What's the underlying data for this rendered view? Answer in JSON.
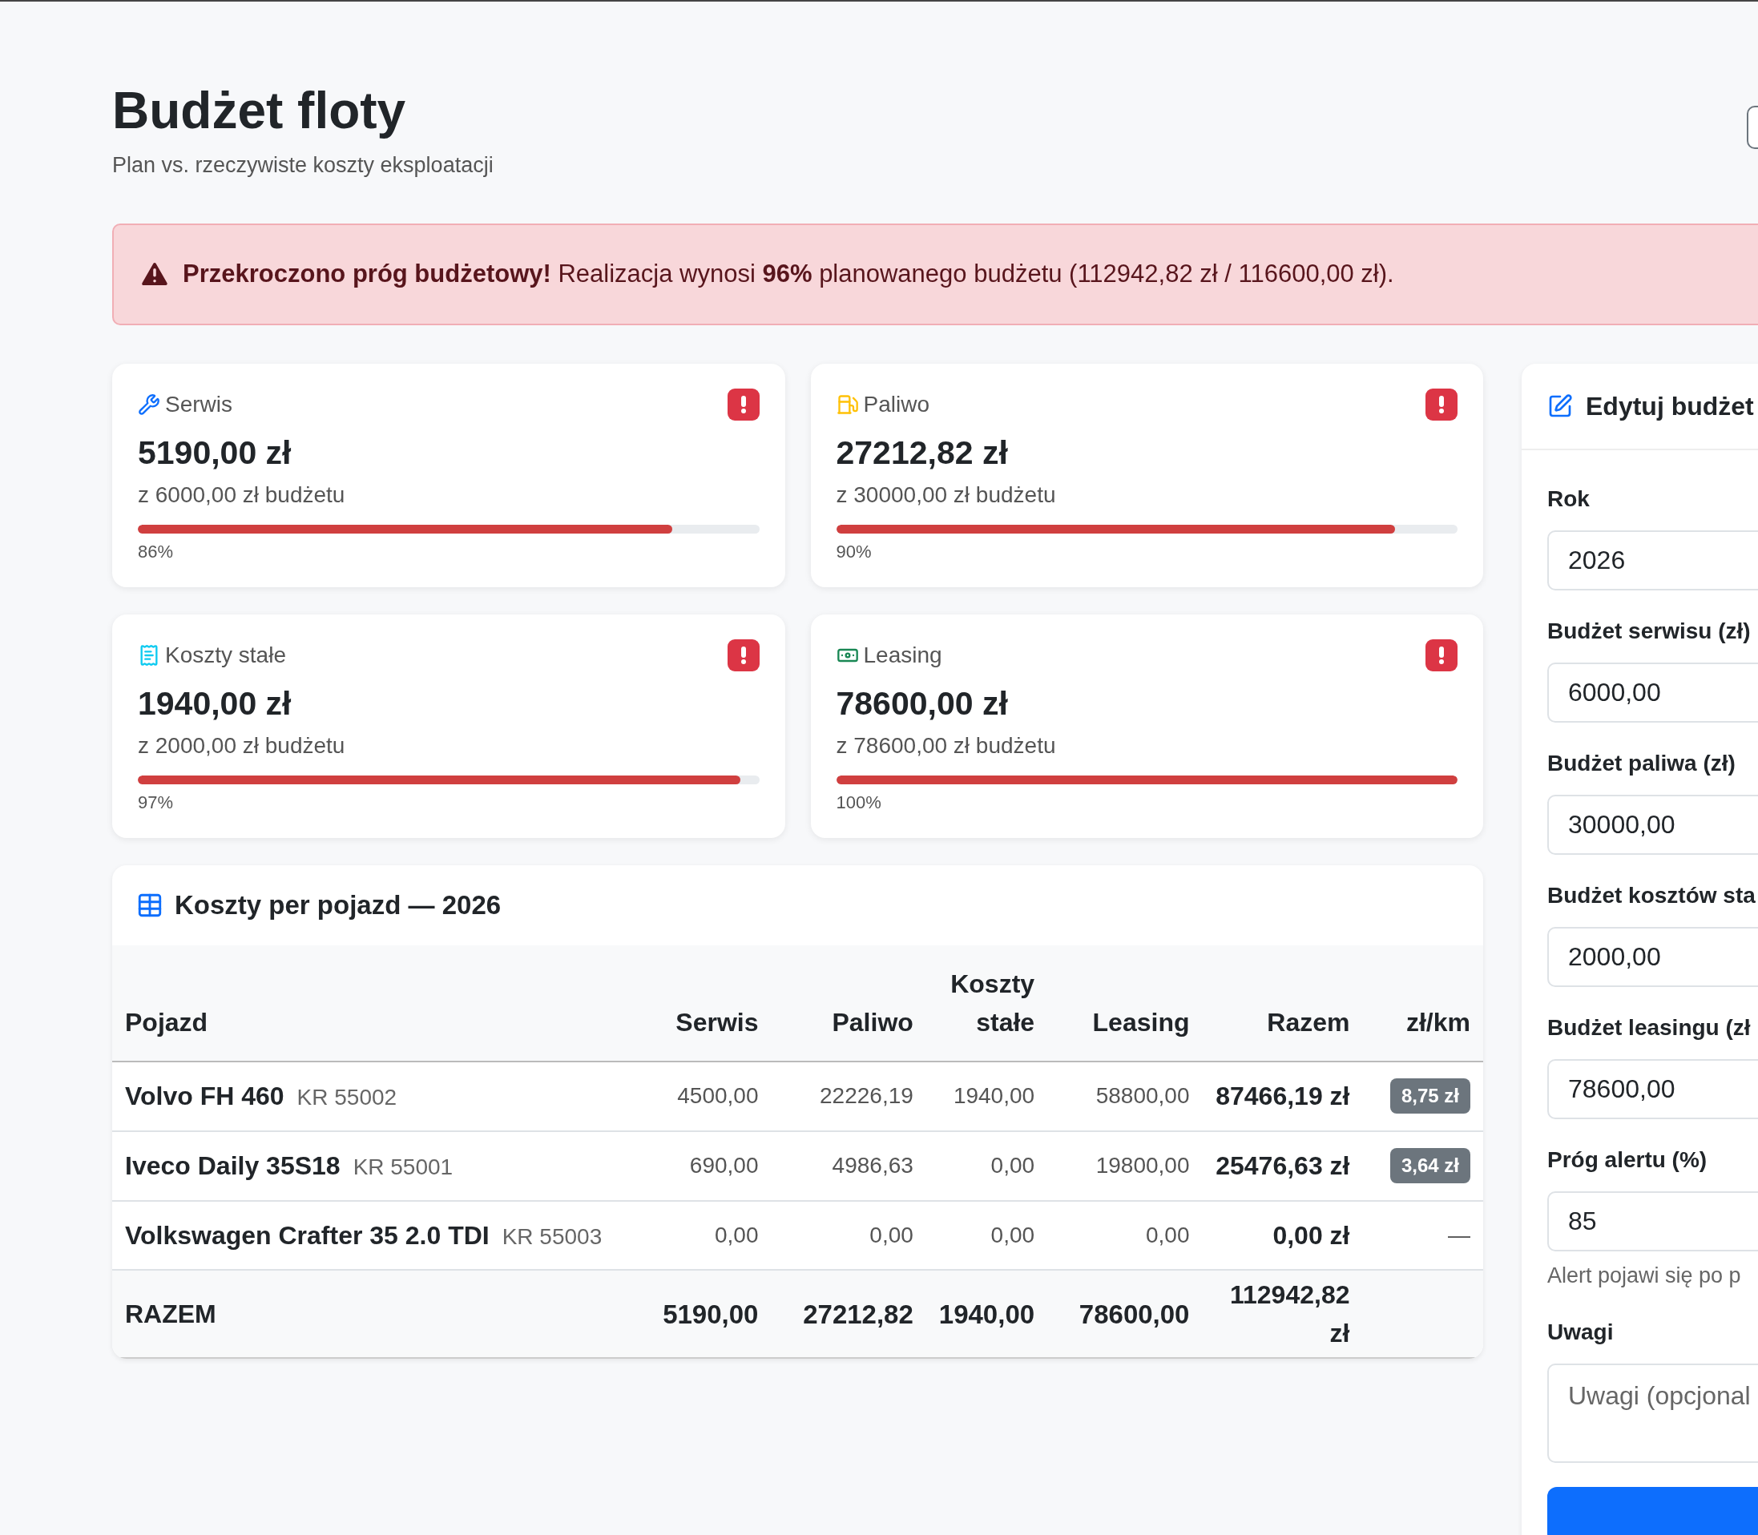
{
  "header": {
    "title": "Budżet floty",
    "subtitle": "Plan vs. rzeczywiste koszty eksploatacji"
  },
  "alert": {
    "text": "**Przekroczono próg budżetowy!** Realizacja wynosi **96%** planowanego budżetu (112942,82 zł / 116600,00 zł)."
  },
  "cards": [
    {
      "kind": "service",
      "label": "Serwis",
      "over_threshold": true,
      "amount": "5190,00 zł",
      "budget": "z 6000,00 zł budżetu",
      "level": 0.86,
      "percent": "86%"
    },
    {
      "kind": "fuel",
      "label": "Paliwo",
      "over_threshold": true,
      "amount": "27212,82 zł",
      "budget": "z 30000,00 zł budżetu",
      "level": 0.9,
      "percent": "90%"
    },
    {
      "kind": "fixed",
      "label": "Koszty stałe",
      "over_threshold": true,
      "amount": "1940,00 zł",
      "budget": "z 2000,00 zł budżetu",
      "level": 0.97,
      "percent": "97%"
    },
    {
      "kind": "leasing",
      "label": "Leasing",
      "over_threshold": true,
      "amount": "78600,00 zł",
      "budget": "z 78600,00 zł budżetu",
      "level": 1,
      "percent": "100%"
    }
  ],
  "table": {
    "title": "Koszty per pojazd — 2026",
    "columns": [
      "Pojazd",
      "Serwis",
      "Paliwo",
      "Koszty stałe",
      "Leasing",
      "Razem",
      "zł/km"
    ],
    "rows": [
      {
        "vehicle": "Volvo FH 460",
        "plate": "KR 55002",
        "service": "4500,00",
        "fuel": "22226,19",
        "fixed": "1940,00",
        "leasing": "58800,00",
        "total": "87466,19 zł",
        "per_km": {
          "kind": "badge",
          "text": "8,75 zł"
        }
      },
      {
        "vehicle": "Iveco Daily 35S18",
        "plate": "KR 55001",
        "service": "690,00",
        "fuel": "4986,63",
        "fixed": "0,00",
        "leasing": "19800,00",
        "total": "25476,63 zł",
        "per_km": {
          "kind": "badge",
          "text": "3,64 zł"
        }
      },
      {
        "vehicle": "Volkswagen Crafter 35 2.0 TDI",
        "plate": "KR 55003",
        "service": "0,00",
        "fuel": "0,00",
        "fixed": "0,00",
        "leasing": "0,00",
        "total": "0,00 zł",
        "per_km": {
          "kind": "dash",
          "text": "—"
        }
      }
    ],
    "footer": {
      "label": "RAZEM",
      "service": "5190,00",
      "fuel": "27212,82",
      "fixed": "1940,00",
      "leasing": "78600,00",
      "total": "112942,82 zł"
    }
  },
  "form": {
    "title": "Edytuj budżet",
    "fields": [
      {
        "kind": "input",
        "label": "Rok",
        "value": "2026"
      },
      {
        "kind": "input",
        "label": "Budżet serwisu (zł)",
        "value": "6000,00"
      },
      {
        "kind": "input",
        "label": "Budżet paliwa (zł)",
        "value": "30000,00"
      },
      {
        "kind": "input",
        "label": "Budżet kosztów sta",
        "value": "2000,00"
      },
      {
        "kind": "input",
        "label": "Budżet leasingu (zł",
        "value": "78600,00"
      },
      {
        "kind": "input",
        "label": "Próg alertu (%)",
        "value": "85",
        "hint": "Alert pojawi się po p"
      },
      {
        "kind": "textarea",
        "label": "Uwagi",
        "placeholder": "Uwagi (opcjonal"
      }
    ]
  }
}
